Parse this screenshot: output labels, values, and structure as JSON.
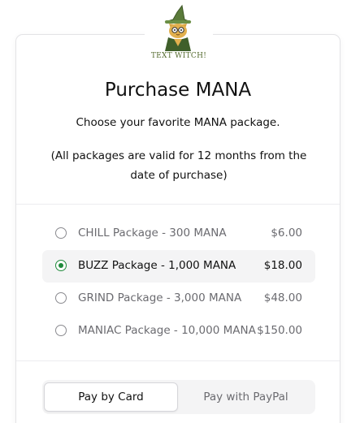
{
  "logo": {
    "text": "TEXT WITCH!",
    "icon": "witch-cat-icon"
  },
  "heading": {
    "title": "Purchase MANA",
    "subtitle": "Choose your favorite MANA package.",
    "validity_note": "(All packages are valid for 12 months from the date of purchase)"
  },
  "packages": [
    {
      "name": "CHILL Package - 300 MANA",
      "price": "$6.00",
      "selected": false
    },
    {
      "name": "BUZZ Package - 1,000 MANA",
      "price": "$18.00",
      "selected": true
    },
    {
      "name": "GRIND Package - 3,000 MANA",
      "price": "$48.00",
      "selected": false
    },
    {
      "name": "MANIAC Package - 10,000 MANA",
      "price": "$150.00",
      "selected": false
    }
  ],
  "payment": {
    "tabs": [
      {
        "label": "Pay by Card",
        "active": true
      },
      {
        "label": "Pay with PayPal",
        "active": false
      }
    ]
  },
  "colors": {
    "accent_green": "#1f8a3b",
    "logo_text": "#556b2f",
    "text_primary": "#111111",
    "text_muted": "#6b6b70",
    "surface_muted": "#f4f4f5"
  }
}
